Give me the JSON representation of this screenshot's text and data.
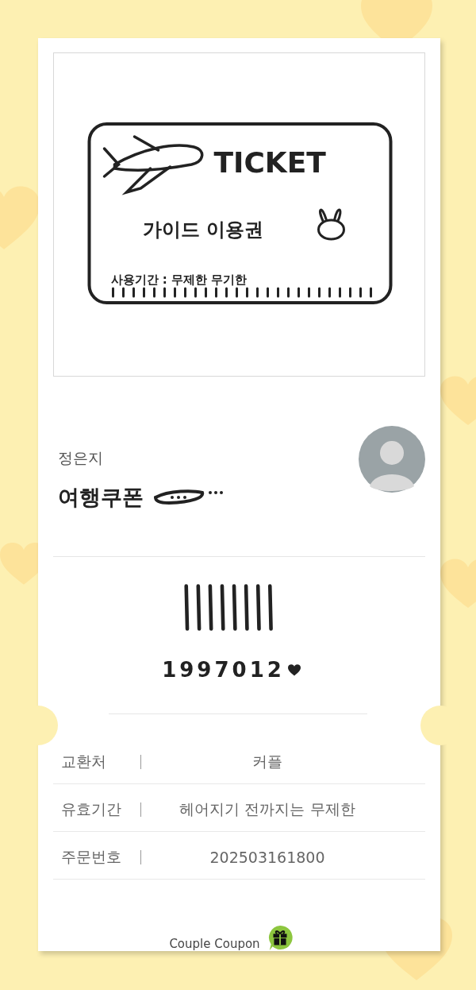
{
  "ticket_image": {
    "title": "TICKET",
    "subtitle": "가이드 이용권",
    "validity": "사용기간 : 무제한 무기한"
  },
  "coupon": {
    "owner": "정은지",
    "title": "여행쿠폰",
    "code": "1997012"
  },
  "details": [
    {
      "label": "교환처",
      "value": "커플"
    },
    {
      "label": "유효기간",
      "value": "헤어지기 전까지는 무제한"
    },
    {
      "label": "주문번호",
      "value": "202503161800"
    }
  ],
  "footer": {
    "brand": "Couple Coupon"
  }
}
